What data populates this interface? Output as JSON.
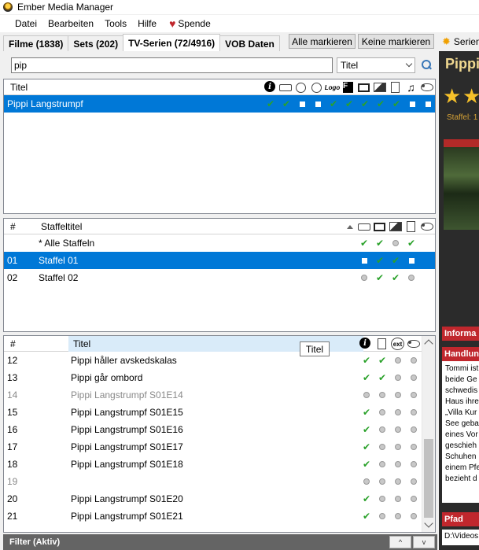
{
  "window": {
    "title": "Ember Media Manager"
  },
  "menu": {
    "items": [
      "Datei",
      "Bearbeiten",
      "Tools",
      "Hilfe"
    ],
    "donate": "Spende"
  },
  "tabs": [
    {
      "label": "Filme (1838)"
    },
    {
      "label": "Sets (202)"
    },
    {
      "label": "TV-Serien (72/4916)"
    },
    {
      "label": "VOB Daten"
    }
  ],
  "toolbar": {
    "mark_all": "Alle markieren",
    "unmark_all": "Keine markieren",
    "series_label": "Serien"
  },
  "search": {
    "value": "pip",
    "field": "Titel"
  },
  "shows": {
    "header": {
      "title": "Titel",
      "logo_icon_text": "Logo",
      "fanart_icon_text": "F"
    },
    "rows": [
      {
        "title": "Pippi Langstrumpf",
        "status": [
          "check",
          "check",
          "square",
          "square",
          "check",
          "check",
          "check",
          "check",
          "check",
          "square",
          "square"
        ]
      }
    ]
  },
  "seasons": {
    "header": {
      "num": "#",
      "title": "Staffeltitel"
    },
    "rows": [
      {
        "num": "",
        "title": "* Alle Staffeln",
        "status": [
          "check",
          "check",
          "dot",
          "check"
        ],
        "selected": false
      },
      {
        "num": "01",
        "title": "Staffel 01",
        "status": [
          "square",
          "check",
          "check",
          "square"
        ],
        "selected": true
      },
      {
        "num": "02",
        "title": "Staffel 02",
        "status": [
          "dot",
          "check",
          "check",
          "dot"
        ],
        "selected": false
      }
    ]
  },
  "episodes": {
    "header": {
      "num": "#",
      "title": "Titel",
      "ext_icon_text": "ext"
    },
    "tooltip": "Titel",
    "rows": [
      {
        "num": "12",
        "title": "Pippi håller avskedskalas",
        "status": [
          "check",
          "check",
          "dot",
          "dot"
        ],
        "muted": false
      },
      {
        "num": "13",
        "title": "Pippi går ombord",
        "status": [
          "check",
          "check",
          "dot",
          "dot"
        ],
        "muted": false
      },
      {
        "num": "14",
        "title": "Pippi Langstrumpf S01E14",
        "status": [
          "dot",
          "dot",
          "dot",
          "dot"
        ],
        "muted": true
      },
      {
        "num": "15",
        "title": "Pippi Langstrumpf S01E15",
        "status": [
          "check",
          "dot",
          "dot",
          "dot"
        ],
        "muted": false
      },
      {
        "num": "16",
        "title": "Pippi Langstrumpf S01E16",
        "status": [
          "check",
          "dot",
          "dot",
          "dot"
        ],
        "muted": false
      },
      {
        "num": "17",
        "title": "Pippi Langstrumpf S01E17",
        "status": [
          "check",
          "dot",
          "dot",
          "dot"
        ],
        "muted": false
      },
      {
        "num": "18",
        "title": "Pippi Langstrumpf S01E18",
        "status": [
          "check",
          "dot",
          "dot",
          "dot"
        ],
        "muted": false
      },
      {
        "num": "19",
        "title": "",
        "status": [
          "dot",
          "dot",
          "dot",
          "dot"
        ],
        "muted": true
      },
      {
        "num": "20",
        "title": "Pippi Langstrumpf S01E20",
        "status": [
          "check",
          "dot",
          "dot",
          "dot"
        ],
        "muted": false
      },
      {
        "num": "21",
        "title": "Pippi Langstrumpf S01E21",
        "status": [
          "check",
          "dot",
          "dot",
          "dot"
        ],
        "muted": false
      }
    ]
  },
  "filter": {
    "label": "Filter (Aktiv)",
    "up": "^",
    "down": "v"
  },
  "details": {
    "title": "Pippi",
    "rating_stars": 2,
    "staffel": "Staffel: 1",
    "info_heading": "Informa",
    "plot_heading": "Handlun",
    "plot_lines": [
      "Tommi ist",
      "beide Ge",
      "schwedis",
      "Haus ihre",
      "„Villa Kur",
      "See geba",
      "eines Vor",
      "geschieh",
      "Schuhen",
      "einem Pfe",
      "bezieht d"
    ],
    "path_heading": "Pfad",
    "path": "D:\\Videos"
  },
  "colors": {
    "selection": "#0078d7",
    "check": "#2aa12a",
    "accent_red": "#c0272d",
    "filter_bar": "#646464",
    "details_bg": "#2b2b2b"
  }
}
